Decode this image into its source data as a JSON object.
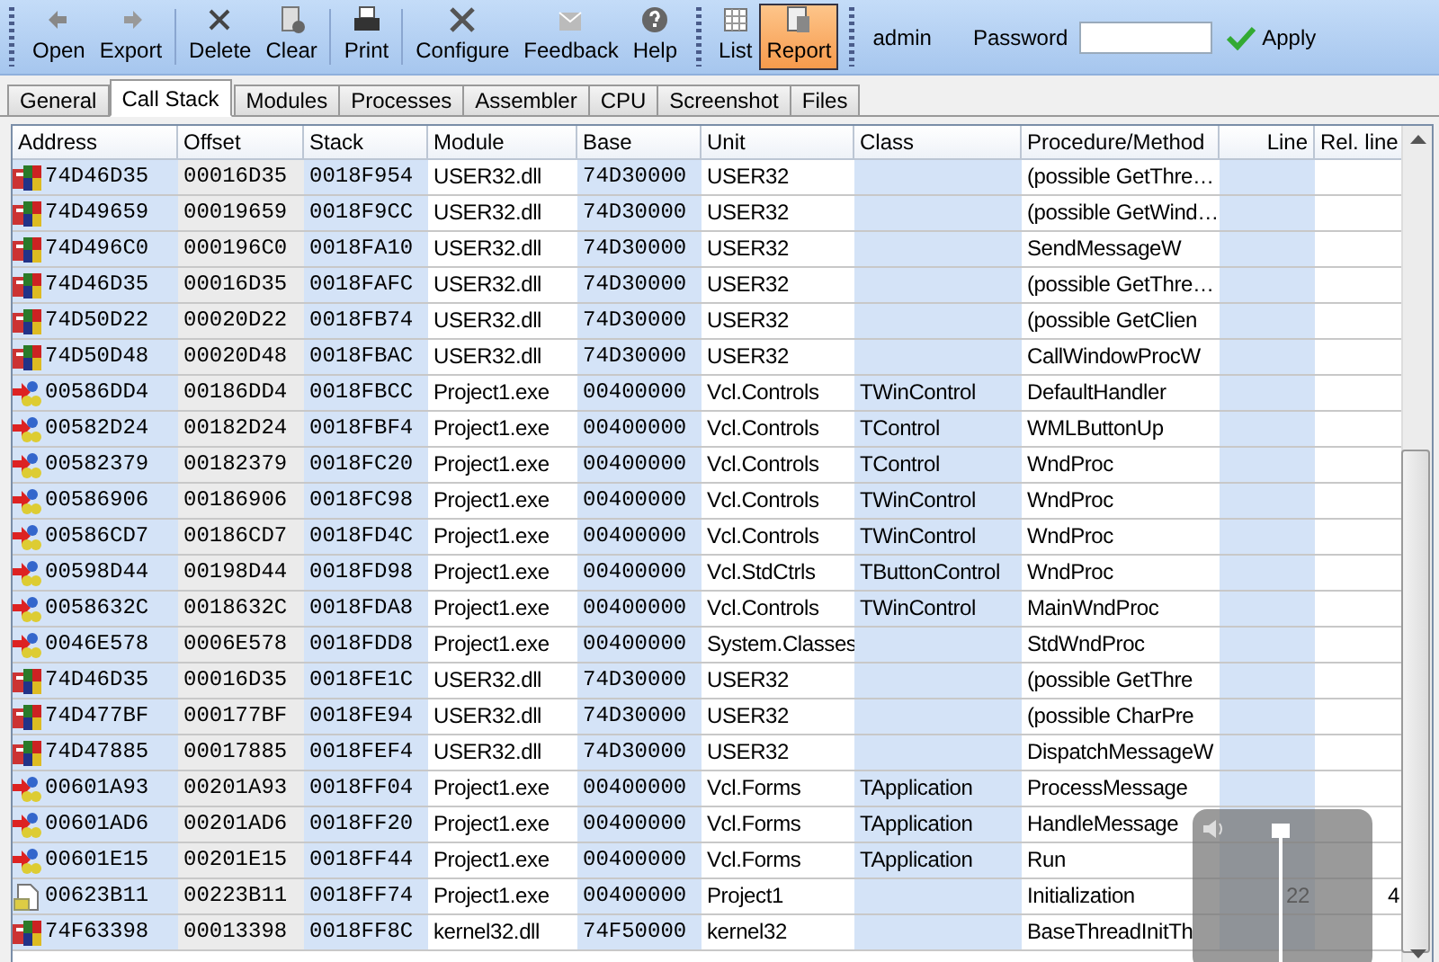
{
  "toolbar": {
    "groups": [
      [
        {
          "label": "Open",
          "selected": false
        },
        {
          "label": "Export",
          "selected": false
        },
        {
          "label": "Delete",
          "selected": false
        },
        {
          "label": "Clear",
          "selected": false
        },
        {
          "label": "Print",
          "selected": false
        },
        {
          "label": "Configure",
          "selected": false
        },
        {
          "label": "Feedback",
          "selected": false
        },
        {
          "label": "Help",
          "selected": false
        }
      ],
      [
        {
          "label": "List",
          "selected": false
        },
        {
          "label": "Report",
          "selected": true
        }
      ]
    ],
    "user": "admin",
    "password_label": "Password",
    "apply": "Apply"
  },
  "tabs": [
    {
      "label": "General",
      "selected": false
    },
    {
      "label": "Call Stack",
      "selected": true
    },
    {
      "label": "Modules",
      "selected": false
    },
    {
      "label": "Processes",
      "selected": false
    },
    {
      "label": "Assembler",
      "selected": false
    },
    {
      "label": "CPU",
      "selected": false
    },
    {
      "label": "Screenshot",
      "selected": false
    },
    {
      "label": "Files",
      "selected": false
    }
  ],
  "table": {
    "columns": [
      "Address",
      "Offset",
      "Stack",
      "Module",
      "Base",
      "Unit",
      "Class",
      "Procedure/Method",
      "Line",
      "Rel. line"
    ],
    "rows": [
      {
        "kind": "system",
        "cells": [
          "74D46D35",
          "00016D35",
          "0018F954",
          "USER32.dll",
          "74D30000",
          "USER32",
          "",
          "(possible GetThre…",
          "",
          ""
        ]
      },
      {
        "kind": "system",
        "cells": [
          "74D49659",
          "00019659",
          "0018F9CC",
          "USER32.dll",
          "74D30000",
          "USER32",
          "",
          "(possible GetWind…",
          "",
          ""
        ]
      },
      {
        "kind": "system",
        "cells": [
          "74D496C0",
          "000196C0",
          "0018FA10",
          "USER32.dll",
          "74D30000",
          "USER32",
          "",
          "SendMessageW",
          "",
          ""
        ]
      },
      {
        "kind": "system",
        "cells": [
          "74D46D35",
          "00016D35",
          "0018FAFC",
          "USER32.dll",
          "74D30000",
          "USER32",
          "",
          "(possible GetThre…",
          "",
          ""
        ]
      },
      {
        "kind": "system",
        "cells": [
          "74D50D22",
          "00020D22",
          "0018FB74",
          "USER32.dll",
          "74D30000",
          "USER32",
          "",
          "(possible GetClien",
          "",
          ""
        ]
      },
      {
        "kind": "system",
        "cells": [
          "74D50D48",
          "00020D48",
          "0018FBAC",
          "USER32.dll",
          "74D30000",
          "USER32",
          "",
          "CallWindowProcW",
          "",
          ""
        ]
      },
      {
        "kind": "vcl",
        "cells": [
          "00586DD4",
          "00186DD4",
          "0018FBCC",
          "Project1.exe",
          "00400000",
          "Vcl.Controls",
          "TWinControl",
          "DefaultHandler",
          "",
          ""
        ]
      },
      {
        "kind": "vcl",
        "cells": [
          "00582D24",
          "00182D24",
          "0018FBF4",
          "Project1.exe",
          "00400000",
          "Vcl.Controls",
          "TControl",
          "WMLButtonUp",
          "",
          ""
        ]
      },
      {
        "kind": "vcl",
        "cells": [
          "00582379",
          "00182379",
          "0018FC20",
          "Project1.exe",
          "00400000",
          "Vcl.Controls",
          "TControl",
          "WndProc",
          "",
          ""
        ]
      },
      {
        "kind": "vcl",
        "cells": [
          "00586906",
          "00186906",
          "0018FC98",
          "Project1.exe",
          "00400000",
          "Vcl.Controls",
          "TWinControl",
          "WndProc",
          "",
          ""
        ]
      },
      {
        "kind": "vcl",
        "cells": [
          "00586CD7",
          "00186CD7",
          "0018FD4C",
          "Project1.exe",
          "00400000",
          "Vcl.Controls",
          "TWinControl",
          "WndProc",
          "",
          ""
        ]
      },
      {
        "kind": "vcl",
        "cells": [
          "00598D44",
          "00198D44",
          "0018FD98",
          "Project1.exe",
          "00400000",
          "Vcl.StdCtrls",
          "TButtonControl",
          "WndProc",
          "",
          ""
        ]
      },
      {
        "kind": "vcl",
        "cells": [
          "0058632C",
          "0018632C",
          "0018FDA8",
          "Project1.exe",
          "00400000",
          "Vcl.Controls",
          "TWinControl",
          "MainWndProc",
          "",
          ""
        ]
      },
      {
        "kind": "vcl",
        "cells": [
          "0046E578",
          "0006E578",
          "0018FDD8",
          "Project1.exe",
          "00400000",
          "System.Classes",
          "",
          "StdWndProc",
          "",
          ""
        ]
      },
      {
        "kind": "system",
        "cells": [
          "74D46D35",
          "00016D35",
          "0018FE1C",
          "USER32.dll",
          "74D30000",
          "USER32",
          "",
          "(possible GetThre",
          "",
          ""
        ]
      },
      {
        "kind": "system",
        "cells": [
          "74D477BF",
          "000177BF",
          "0018FE94",
          "USER32.dll",
          "74D30000",
          "USER32",
          "",
          "(possible CharPre",
          "",
          ""
        ]
      },
      {
        "kind": "system",
        "cells": [
          "74D47885",
          "00017885",
          "0018FEF4",
          "USER32.dll",
          "74D30000",
          "USER32",
          "",
          "DispatchMessageW",
          "",
          ""
        ]
      },
      {
        "kind": "vcl",
        "cells": [
          "00601A93",
          "00201A93",
          "0018FF04",
          "Project1.exe",
          "00400000",
          "Vcl.Forms",
          "TApplication",
          "ProcessMessage",
          "",
          ""
        ]
      },
      {
        "kind": "vcl",
        "cells": [
          "00601AD6",
          "00201AD6",
          "0018FF20",
          "Project1.exe",
          "00400000",
          "Vcl.Forms",
          "TApplication",
          "HandleMessage",
          "",
          ""
        ]
      },
      {
        "kind": "vcl",
        "cells": [
          "00601E15",
          "00201E15",
          "0018FF44",
          "Project1.exe",
          "00400000",
          "Vcl.Forms",
          "TApplication",
          "Run",
          "",
          ""
        ]
      },
      {
        "kind": "project",
        "cells": [
          "00623B11",
          "00223B11",
          "0018FF74",
          "Project1.exe",
          "00400000",
          "Project1",
          "",
          "Initialization",
          "22",
          "4"
        ]
      },
      {
        "kind": "system",
        "cells": [
          "74F63398",
          "00013398",
          "0018FF8C",
          "kernel32.dll",
          "74F50000",
          "kernel32",
          "",
          "BaseThreadInitTh",
          "",
          ""
        ]
      }
    ]
  },
  "volume": {
    "level": 1
  }
}
